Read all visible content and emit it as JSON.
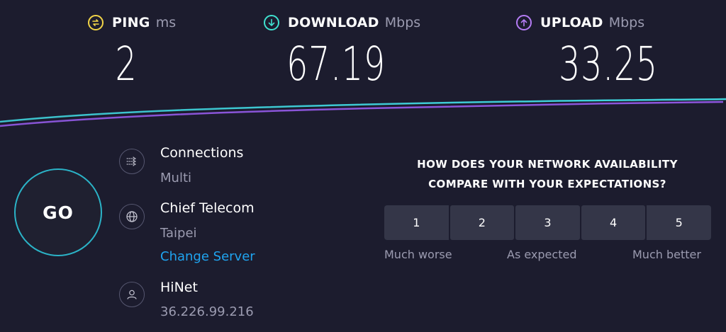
{
  "metrics": {
    "ping": {
      "label": "PING",
      "unit": "ms",
      "value": "2",
      "color": "#f1d447"
    },
    "download": {
      "label": "DOWNLOAD",
      "unit": "Mbps",
      "value": "67.19",
      "color": "#3fe0cf"
    },
    "upload": {
      "label": "UPLOAD",
      "unit": "Mbps",
      "value": "33.25",
      "color": "#b57cf5"
    }
  },
  "graph": {
    "download_color": "#3fd3dc",
    "upload_color": "#9a5df2"
  },
  "go_button": {
    "label": "GO",
    "ring_color": "#2bb3c7"
  },
  "connections": {
    "title": "Connections",
    "mode": "Multi"
  },
  "server": {
    "name": "Chief Telecom",
    "location": "Taipei",
    "change_label": "Change Server"
  },
  "isp": {
    "name": "HiNet",
    "ip": "36.226.99.216"
  },
  "survey": {
    "question_line1": "HOW DOES YOUR NETWORK AVAILABILITY",
    "question_line2": "COMPARE WITH YOUR EXPECTATIONS?",
    "options": [
      "1",
      "2",
      "3",
      "4",
      "5"
    ],
    "label_low": "Much worse",
    "label_mid": "As expected",
    "label_high": "Much better"
  }
}
